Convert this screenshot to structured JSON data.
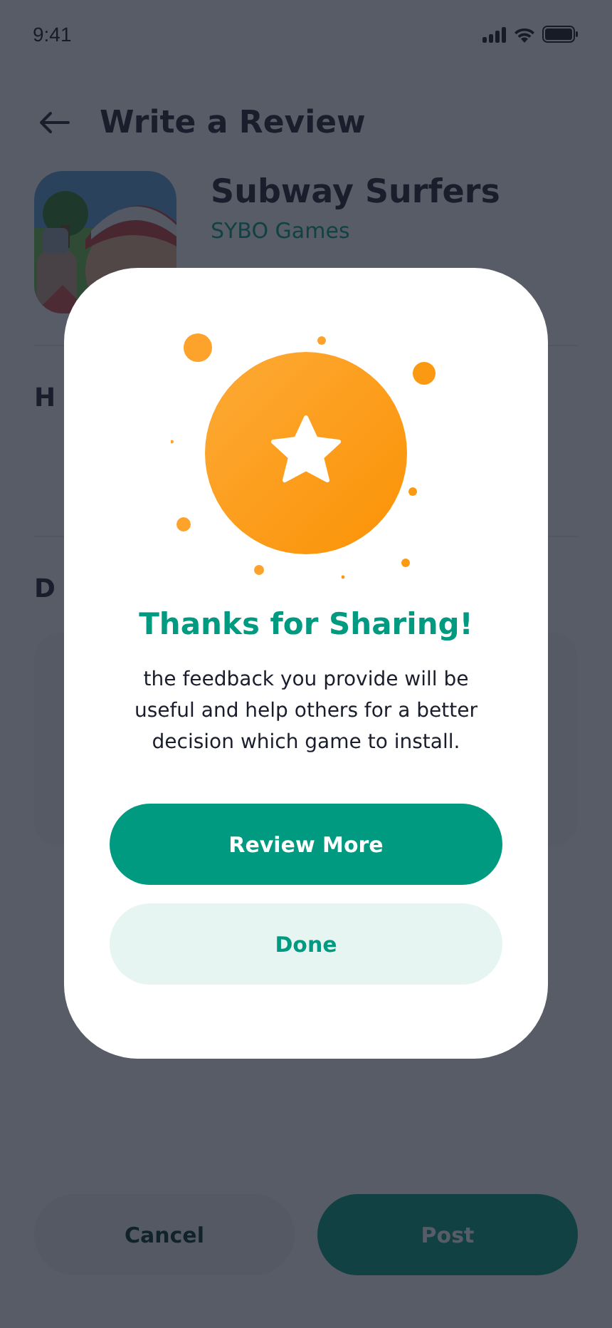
{
  "status_bar": {
    "time": "9:41"
  },
  "header": {
    "title": "Write a Review"
  },
  "app": {
    "name": "Subway Surfers",
    "developer": "SYBO Games"
  },
  "sections": [
    {
      "heading": "H"
    },
    {
      "heading": "D"
    }
  ],
  "footer_buttons": [
    {
      "label": "Cancel",
      "kind": "secondary"
    },
    {
      "label": "Post",
      "kind": "primary"
    }
  ],
  "dialog": {
    "title": "Thanks for Sharing!",
    "message": "the feedback you provide will be useful and help others for a better decision which game to install.",
    "buttons": [
      {
        "label": "Review More",
        "kind": "primary"
      },
      {
        "label": "Done",
        "kind": "secondary"
      }
    ]
  }
}
